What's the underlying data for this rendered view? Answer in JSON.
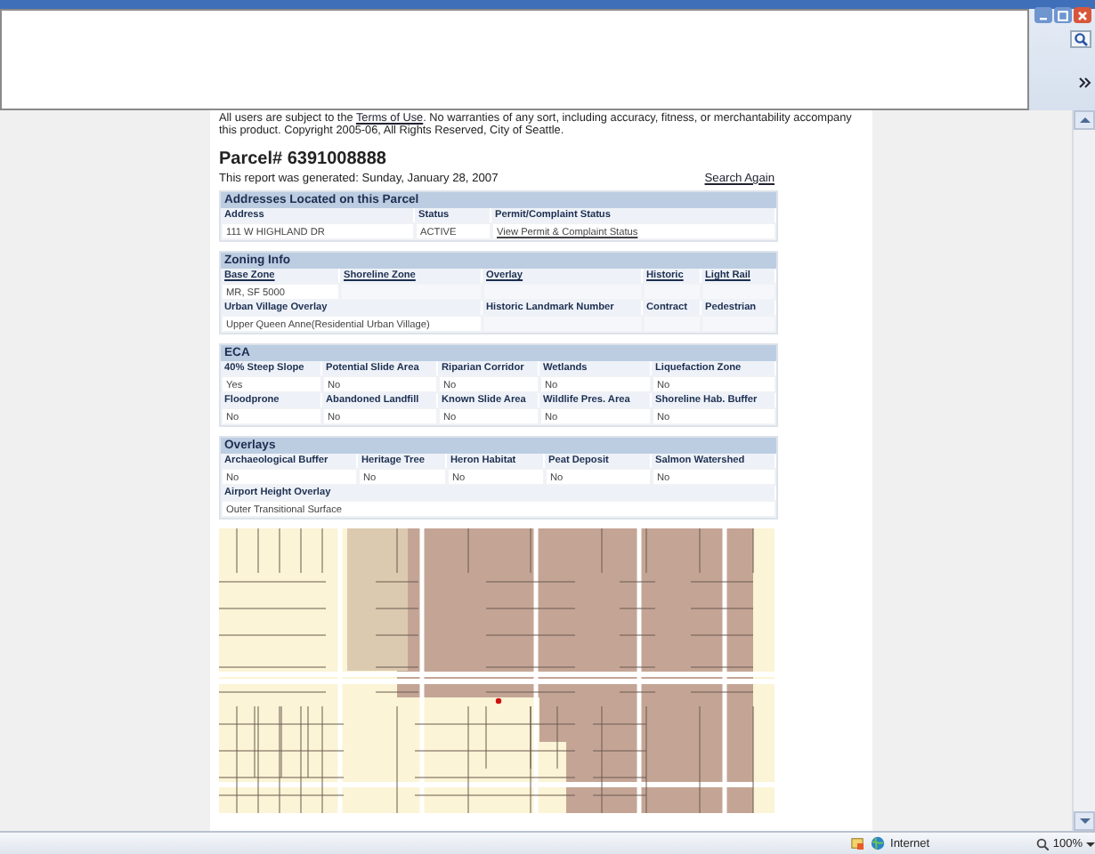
{
  "report": {
    "disclaimer": {
      "before": "All users are subject to the",
      "link": "Terms of Use",
      "after": ".  No warranties of any sort, including accuracy, fitness, or merchantability accompany this product. Copyright 2005-06, All Rights Reserved, City of Seattle."
    },
    "title": "Parcel# 6391008888",
    "generated": "This report was generated: Sunday, January 28, 2007",
    "search_again": "Search Again",
    "sections": [
      {
        "title": "Addresses Located on this Parcel",
        "tables": [
          {
            "rows": [
              {
                "kind": "header",
                "cells": [
                  {
                    "text": "Address"
                  },
                  {
                    "text": "Status"
                  },
                  {
                    "text": "Permit/Complaint Status"
                  }
                ]
              },
              {
                "kind": "data",
                "cells": [
                  {
                    "text": "111 W HIGHLAND DR"
                  },
                  {
                    "text": "ACTIVE"
                  },
                  {
                    "text": "View Permit & Complaint Status",
                    "link": true
                  }
                ]
              }
            ]
          }
        ]
      },
      {
        "title": "Zoning Info",
        "tables": [
          {
            "rows": [
              {
                "kind": "header",
                "cells": [
                  {
                    "text": "Base Zone",
                    "link": true
                  },
                  {
                    "text": "Shoreline Zone",
                    "link": true
                  },
                  {
                    "text": "Overlay",
                    "link": true
                  },
                  {
                    "text": "Historic",
                    "link": true
                  },
                  {
                    "text": "Light Rail",
                    "link": true
                  }
                ]
              },
              {
                "kind": "data",
                "cells": [
                  {
                    "text": "MR, SF 5000"
                  },
                  {
                    "text": ""
                  },
                  {
                    "text": ""
                  },
                  {
                    "text": ""
                  },
                  {
                    "text": ""
                  }
                ]
              }
            ]
          },
          {
            "rows": [
              {
                "kind": "header",
                "cells": [
                  {
                    "text": "Urban Village Overlay"
                  },
                  {
                    "text": "Historic Landmark Number"
                  },
                  {
                    "text": "Contract"
                  },
                  {
                    "text": "Pedestrian"
                  }
                ]
              },
              {
                "kind": "data",
                "cells": [
                  {
                    "text": "Upper Queen Anne(Residential Urban Village)"
                  },
                  {
                    "text": ""
                  },
                  {
                    "text": ""
                  },
                  {
                    "text": ""
                  }
                ]
              }
            ]
          }
        ]
      },
      {
        "title": "ECA",
        "tables": [
          {
            "rows": [
              {
                "kind": "header",
                "cells": [
                  {
                    "text": "40% Steep Slope"
                  },
                  {
                    "text": "Potential Slide Area"
                  },
                  {
                    "text": "Riparian Corridor"
                  },
                  {
                    "text": "Wetlands"
                  },
                  {
                    "text": "Liquefaction Zone"
                  }
                ]
              },
              {
                "kind": "data",
                "cells": [
                  {
                    "text": "Yes"
                  },
                  {
                    "text": "No"
                  },
                  {
                    "text": "No"
                  },
                  {
                    "text": "No"
                  },
                  {
                    "text": "No"
                  }
                ]
              },
              {
                "kind": "header",
                "cells": [
                  {
                    "text": "Floodprone"
                  },
                  {
                    "text": "Abandoned Landfill"
                  },
                  {
                    "text": "Known Slide Area"
                  },
                  {
                    "text": "Wildlife Pres. Area"
                  },
                  {
                    "text": "Shoreline Hab. Buffer"
                  }
                ]
              },
              {
                "kind": "data",
                "cells": [
                  {
                    "text": "No"
                  },
                  {
                    "text": "No"
                  },
                  {
                    "text": "No"
                  },
                  {
                    "text": "No"
                  },
                  {
                    "text": "No"
                  }
                ]
              }
            ]
          }
        ]
      },
      {
        "title": "Overlays",
        "tables": [
          {
            "rows": [
              {
                "kind": "header",
                "cells": [
                  {
                    "text": "Archaeological Buffer"
                  },
                  {
                    "text": "Heritage Tree"
                  },
                  {
                    "text": "Heron Habitat"
                  },
                  {
                    "text": "Peat Deposit"
                  },
                  {
                    "text": "Salmon Watershed"
                  }
                ]
              },
              {
                "kind": "data",
                "cells": [
                  {
                    "text": "No"
                  },
                  {
                    "text": "No"
                  },
                  {
                    "text": "No"
                  },
                  {
                    "text": "No"
                  },
                  {
                    "text": "No"
                  }
                ]
              }
            ]
          },
          {
            "rows": [
              {
                "kind": "header",
                "cells": [
                  {
                    "text": "Airport Height Overlay"
                  }
                ]
              },
              {
                "kind": "data",
                "cells": [
                  {
                    "text": "Outer Transitional Surface"
                  }
                ]
              }
            ]
          }
        ]
      }
    ]
  },
  "status_bar": {
    "zone": "Internet",
    "zoom": "100%"
  }
}
